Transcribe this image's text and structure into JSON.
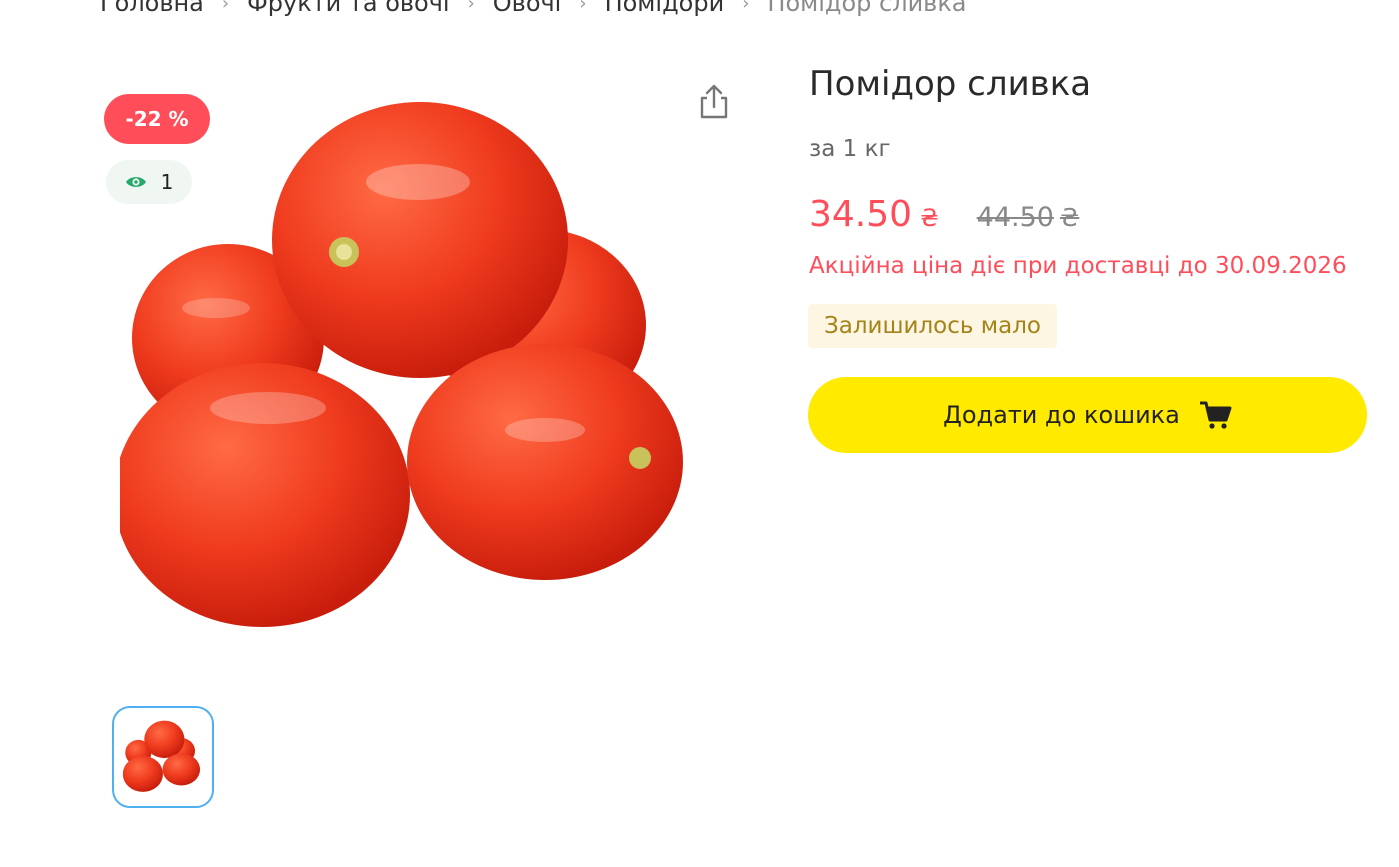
{
  "breadcrumb": [
    {
      "label": "Головна"
    },
    {
      "label": "Фрукти та овочі"
    },
    {
      "label": "Овочі"
    },
    {
      "label": "Помідори"
    },
    {
      "label": "Помідор сливка"
    }
  ],
  "badges": {
    "discount": "-22 %",
    "views": "1"
  },
  "product": {
    "title": "Помідор сливка",
    "unit": "за 1 кг",
    "price": "34.50",
    "currency": "₴",
    "old_price": "44.50",
    "promo_text": "Акційна ціна діє при доставці до 30.09.2026",
    "stock_text": "Залишилось мало",
    "add_to_cart_label": "Додати до кошика"
  },
  "icons": {
    "share": "share-icon",
    "eye": "eye-icon",
    "cart": "cart-icon"
  },
  "colors": {
    "accent_red": "#ff4d5a",
    "button_yellow": "#ffea00",
    "view_green": "#27a86b",
    "stock_bg": "#fdf6e3",
    "stock_text": "#a48318",
    "thumb_border": "#4fb0f0"
  }
}
